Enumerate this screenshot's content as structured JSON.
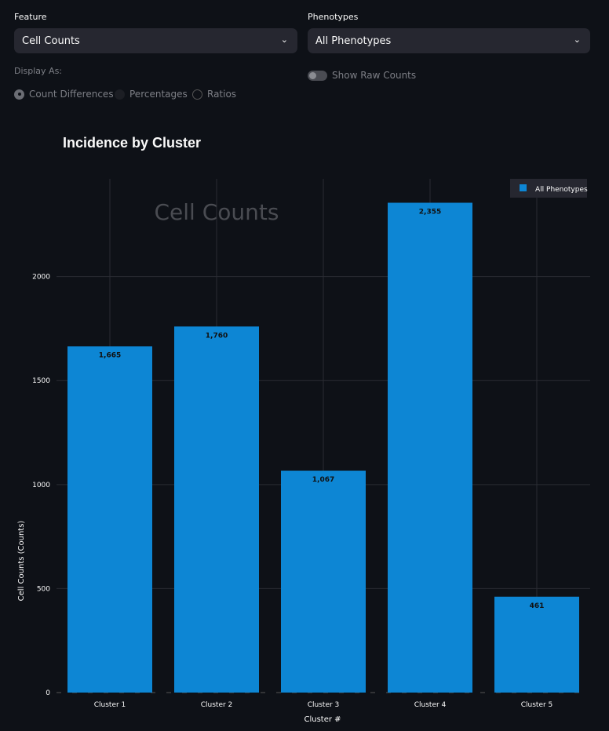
{
  "controls": {
    "feature_label": "Feature",
    "feature_value": "Cell Counts",
    "phenotypes_label": "Phenotypes",
    "phenotypes_value": "All Phenotypes",
    "display_as_label": "Display As:",
    "display_options": [
      "Count Differences",
      "Percentages",
      "Ratios"
    ],
    "display_selected": "Count Differences",
    "raw_counts_label": "Show Raw Counts",
    "raw_counts_on": false
  },
  "chart_data": {
    "type": "bar",
    "title": "Incidence by Cluster",
    "watermark": "Cell Counts",
    "xlabel": "Cluster #",
    "ylabel": "Cell Counts (Counts)",
    "categories": [
      "Cluster 1",
      "Cluster 2",
      "Cluster 3",
      "Cluster 4",
      "Cluster 5"
    ],
    "series": [
      {
        "name": "All Phenotypes",
        "values": [
          1665,
          1760,
          1067,
          2355,
          461
        ],
        "labels": [
          "1,665",
          "1,760",
          "1,067",
          "2,355",
          "461"
        ],
        "color": "#0d86d4"
      }
    ],
    "yticks": [
      0,
      500,
      1000,
      1500,
      2000
    ],
    "ylim": [
      0,
      2470
    ],
    "grid": true,
    "legend": "top-right"
  }
}
